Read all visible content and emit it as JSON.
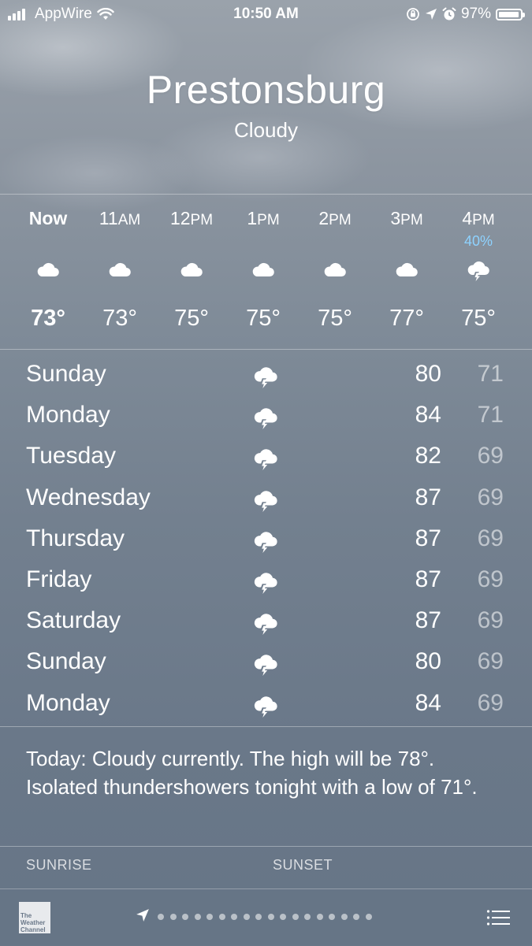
{
  "status_bar": {
    "carrier": "AppWire",
    "time": "10:50 AM",
    "battery": "97%"
  },
  "location": {
    "city": "Prestonsburg",
    "condition": "Cloudy"
  },
  "hourly": [
    {
      "time": "Now",
      "ampm": "",
      "pop": "",
      "icon": "cloud-icon",
      "temp": "73°"
    },
    {
      "time": "11",
      "ampm": "AM",
      "pop": "",
      "icon": "cloud-icon",
      "temp": "73°"
    },
    {
      "time": "12",
      "ampm": "PM",
      "pop": "",
      "icon": "cloud-icon",
      "temp": "75°"
    },
    {
      "time": "1",
      "ampm": "PM",
      "pop": "",
      "icon": "cloud-icon",
      "temp": "75°"
    },
    {
      "time": "2",
      "ampm": "PM",
      "pop": "",
      "icon": "cloud-icon",
      "temp": "75°"
    },
    {
      "time": "3",
      "ampm": "PM",
      "pop": "",
      "icon": "cloud-icon",
      "temp": "77°"
    },
    {
      "time": "4",
      "ampm": "PM",
      "pop": "40%",
      "icon": "thunderstorm-icon",
      "temp": "75°"
    }
  ],
  "daily": [
    {
      "day": "Sunday",
      "icon": "thunderstorm-icon",
      "high": "80",
      "low": "71"
    },
    {
      "day": "Monday",
      "icon": "thunderstorm-icon",
      "high": "84",
      "low": "71"
    },
    {
      "day": "Tuesday",
      "icon": "thunderstorm-icon",
      "high": "82",
      "low": "69"
    },
    {
      "day": "Wednesday",
      "icon": "thunderstorm-icon",
      "high": "87",
      "low": "69"
    },
    {
      "day": "Thursday",
      "icon": "thunderstorm-icon",
      "high": "87",
      "low": "69"
    },
    {
      "day": "Friday",
      "icon": "thunderstorm-icon",
      "high": "87",
      "low": "69"
    },
    {
      "day": "Saturday",
      "icon": "thunderstorm-icon",
      "high": "87",
      "low": "69"
    },
    {
      "day": "Sunday",
      "icon": "thunderstorm-icon",
      "high": "80",
      "low": "69"
    },
    {
      "day": "Monday",
      "icon": "thunderstorm-icon",
      "high": "84",
      "low": "69"
    }
  ],
  "summary": "Today: Cloudy currently. The high will be 78°. Isolated thundershowers tonight with a low of 71°.",
  "details": {
    "sunrise_label": "SUNRISE",
    "sunset_label": "SUNSET"
  },
  "toolbar": {
    "logo_text": "The Weather Channel",
    "page_count": 18
  },
  "colors": {
    "pop_text": "#8ed2ff",
    "background": "#73808f"
  }
}
